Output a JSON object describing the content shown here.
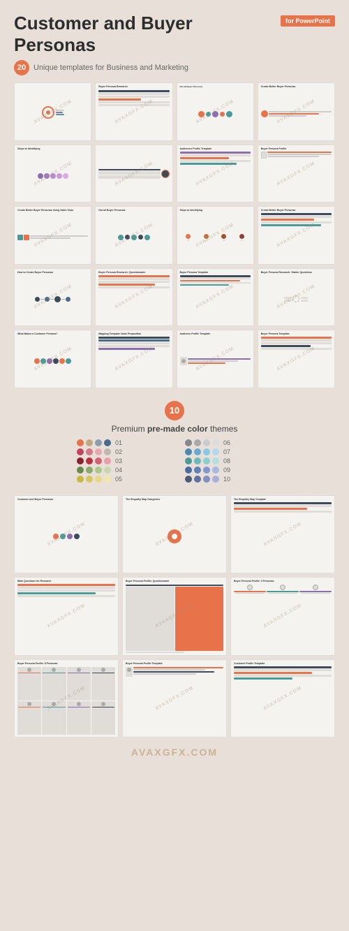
{
  "header": {
    "title": "Customer and Buyer Personas",
    "badge": "for PowerPoint",
    "count": "20",
    "subtitle": "Unique templates for Business and Marketing"
  },
  "themes": {
    "count": "10",
    "label": "Premium",
    "highlight": "pre-made color",
    "suffix": "themes",
    "rows": [
      {
        "num": "01",
        "colors": [
          "#e8724a",
          "#c0a882",
          "#8b9db0",
          "#4a6a8a"
        ]
      },
      {
        "num": "02",
        "colors": [
          "#c0445a",
          "#d4788a",
          "#e8a8b0",
          "#c0b8b0"
        ]
      },
      {
        "num": "03",
        "colors": [
          "#8b2030",
          "#b83040",
          "#d46070",
          "#e8a0a8"
        ]
      },
      {
        "num": "04",
        "colors": [
          "#6a8a4a",
          "#8aaa6a",
          "#aac88a",
          "#c8d8b0"
        ]
      },
      {
        "num": "05",
        "colors": [
          "#c8b840",
          "#d8c860",
          "#e8d880",
          "#f0e8a8"
        ]
      },
      {
        "num": "06",
        "colors": [
          "#888",
          "#aaa",
          "#ccc",
          "#ddd"
        ]
      },
      {
        "num": "07",
        "colors": [
          "#4a8ab0",
          "#6aaad0",
          "#8ac8e8",
          "#b0d8f0"
        ]
      },
      {
        "num": "08",
        "colors": [
          "#4a9a9a",
          "#6ab8b8",
          "#8ad0d0",
          "#b0e0e0"
        ]
      },
      {
        "num": "09",
        "colors": [
          "#4a6aa0",
          "#6080b8",
          "#8098d0",
          "#a8b8e0"
        ]
      },
      {
        "num": "10",
        "colors": [
          "#4a5a78",
          "#6070a0",
          "#8090c0",
          "#a8b0d8"
        ]
      }
    ]
  },
  "slides_top": [
    {
      "id": 1,
      "type": "mind-map",
      "title": ""
    },
    {
      "id": 2,
      "type": "questionnaire",
      "title": "Buyer Persona Research: Questionnaire"
    },
    {
      "id": 3,
      "type": "circles-orange",
      "title": "Not all Buyer Personas are Right for you Company"
    },
    {
      "id": 4,
      "type": "profile",
      "title": "Create Better Buyer Personas"
    },
    {
      "id": 5,
      "type": "steps-purple",
      "title": "Steps to Identifying your Negative Persona"
    },
    {
      "id": 6,
      "type": "timeline",
      "title": ""
    },
    {
      "id": 7,
      "type": "audience",
      "title": "Audiences Profile Template"
    },
    {
      "id": 8,
      "type": "profile-photo",
      "title": "Buyer Persona Profile Template"
    },
    {
      "id": 9,
      "type": "sales-team",
      "title": "Create Better Buyer Personas Using Your Sales Team"
    },
    {
      "id": 10,
      "type": "circles-teal",
      "title": "Not all Buyer Personas are Right for you Company"
    },
    {
      "id": 11,
      "type": "steps-orange",
      "title": "Steps to Identifying your Negative Persona"
    },
    {
      "id": 12,
      "type": "sales-team2",
      "title": "Create Better Buyer Personas Using Your Sales Team"
    },
    {
      "id": 13,
      "type": "how-to",
      "title": "How to Create Buyer Personas"
    },
    {
      "id": 14,
      "type": "questionnaire2",
      "title": "Buyer Persona Research: Questionnaire"
    },
    {
      "id": 15,
      "type": "template",
      "title": "Buyer Persona Template"
    },
    {
      "id": 16,
      "type": "starter",
      "title": "Buyer Persona Research: Starter Questions"
    },
    {
      "id": 17,
      "type": "what-makes",
      "title": "What Makes a Customer Persona?"
    },
    {
      "id": 18,
      "type": "mapping",
      "title": "Mapping Template Buyer Persona Value Proposition (Table)"
    },
    {
      "id": 19,
      "type": "audience2",
      "title": "Audience Profile Template"
    },
    {
      "id": 20,
      "type": "persona-template",
      "title": "Buyer Persona Template"
    }
  ],
  "slides_bottom": [
    {
      "id": 21,
      "title": "Customer and Buyer Personas"
    },
    {
      "id": 22,
      "title": "The Empathy Map Categories"
    },
    {
      "id": 23,
      "title": "The Empathy Map Template"
    },
    {
      "id": 24,
      "title": "Main Questions for Research Marketing and Sales Buyers Persona"
    },
    {
      "id": 25,
      "title": "Buyer Persona Profile: Questionnaire Template"
    },
    {
      "id": 26,
      "title": "Buyer Persona Profile: 3 Personas"
    },
    {
      "id": 27,
      "title": "Buyer Persona Profile: 8 Personas"
    },
    {
      "id": 28,
      "title": "Buyer Persona Profile Template"
    },
    {
      "id": 29,
      "title": "Customer Profile Template"
    }
  ],
  "watermark": "AVAXGFX.COM",
  "avax_logo": "AVAXGFX.COM"
}
